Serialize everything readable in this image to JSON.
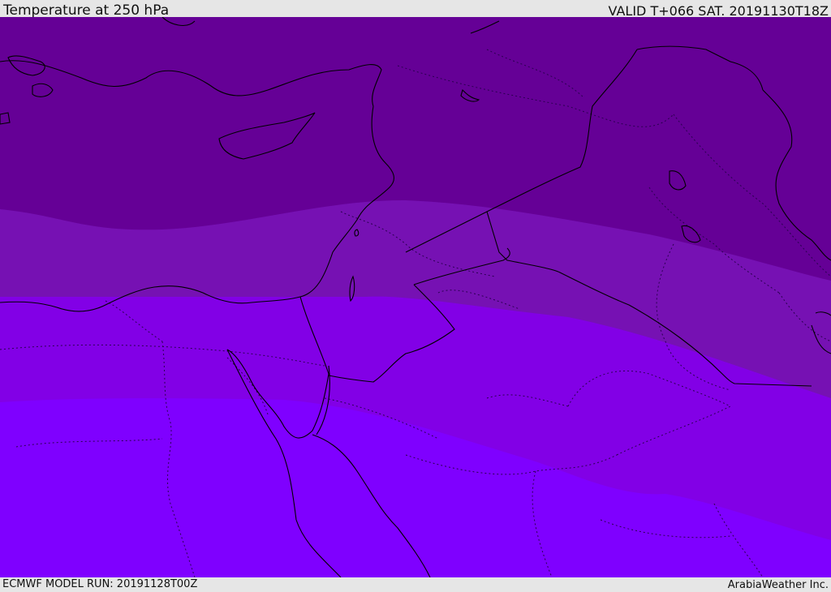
{
  "header": {
    "title": "Temperature at 250 hPa",
    "valid": "VALID T+066 SAT. 20191130T18Z"
  },
  "footer": {
    "model_run": "ECMWF MODEL RUN: 20191128T00Z",
    "credit": "ArabiaWeather Inc."
  },
  "colors": {
    "band_coldest": "#650096",
    "band_cold": "#7611b3",
    "band_mid": "#8200e6",
    "band_warm": "#7f00ff",
    "coast": "#000000",
    "border": "#2a0050"
  }
}
